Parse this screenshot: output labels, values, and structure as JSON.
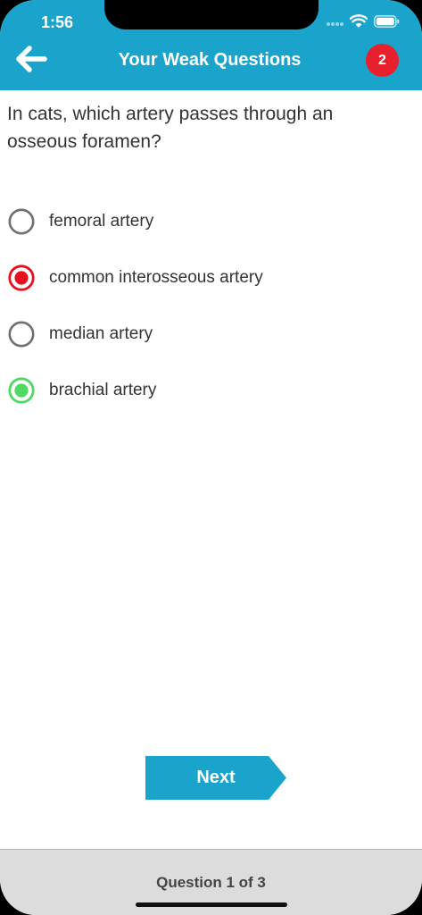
{
  "status_bar": {
    "time": "1:56",
    "wifi_icon": "wifi-icon",
    "battery_icon": "battery-icon"
  },
  "header": {
    "back_icon": "arrow-left-icon",
    "title": "Your Weak Questions",
    "badge_count": "2",
    "color": "#1aa3cb",
    "badge_color": "#e8202e"
  },
  "question": {
    "text": "In cats, which artery passes through an osseous foramen?"
  },
  "options": [
    {
      "label": "femoral artery",
      "state": "unselected"
    },
    {
      "label": "common interosseous artery",
      "state": "selected-wrong"
    },
    {
      "label": "median artery",
      "state": "unselected"
    },
    {
      "label": "brachial artery",
      "state": "correct"
    }
  ],
  "colors": {
    "wrong": "#e8101e",
    "correct": "#4cd964",
    "unselected": "#6f6f6f"
  },
  "next_button": {
    "label": "Next"
  },
  "footer": {
    "progress_text": "Question 1 of 3"
  }
}
